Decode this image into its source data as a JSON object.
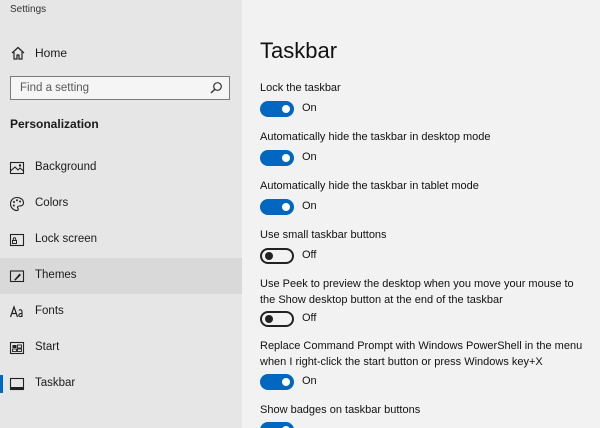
{
  "window": {
    "title": "Settings"
  },
  "sidebar": {
    "home_label": "Home",
    "search_placeholder": "Find a setting",
    "section_heading": "Personalization",
    "items": [
      {
        "label": "Background",
        "icon": "picture-icon"
      },
      {
        "label": "Colors",
        "icon": "palette-icon"
      },
      {
        "label": "Lock screen",
        "icon": "lock-screen-icon"
      },
      {
        "label": "Themes",
        "icon": "brush-icon"
      },
      {
        "label": "Fonts",
        "icon": "font-icon"
      },
      {
        "label": "Start",
        "icon": "start-icon"
      },
      {
        "label": "Taskbar",
        "icon": "taskbar-icon"
      }
    ],
    "hovered_item": "Themes",
    "current_item": "Taskbar"
  },
  "main": {
    "title": "Taskbar",
    "settings": [
      {
        "label": "Lock the taskbar",
        "state": "On",
        "on": true
      },
      {
        "label": "Automatically hide the taskbar in desktop mode",
        "state": "On",
        "on": true
      },
      {
        "label": "Automatically hide the taskbar in tablet mode",
        "state": "On",
        "on": true
      },
      {
        "label": "Use small taskbar buttons",
        "state": "Off",
        "on": false
      },
      {
        "label": "Use Peek to preview the desktop when you move your mouse to the Show desktop button at the end of the taskbar",
        "state": "Off",
        "on": false
      },
      {
        "label": "Replace Command Prompt with Windows PowerShell in the menu when I right-click the start button or press Windows key+X",
        "state": "On",
        "on": true
      },
      {
        "label": "Show badges on taskbar buttons",
        "state": "On",
        "on": true
      }
    ]
  },
  "colors": {
    "accent": "#0067c0",
    "highlight_border": "#f0f000",
    "sidebar_bg": "#e6e6e6",
    "main_bg": "#f2f2f2"
  }
}
